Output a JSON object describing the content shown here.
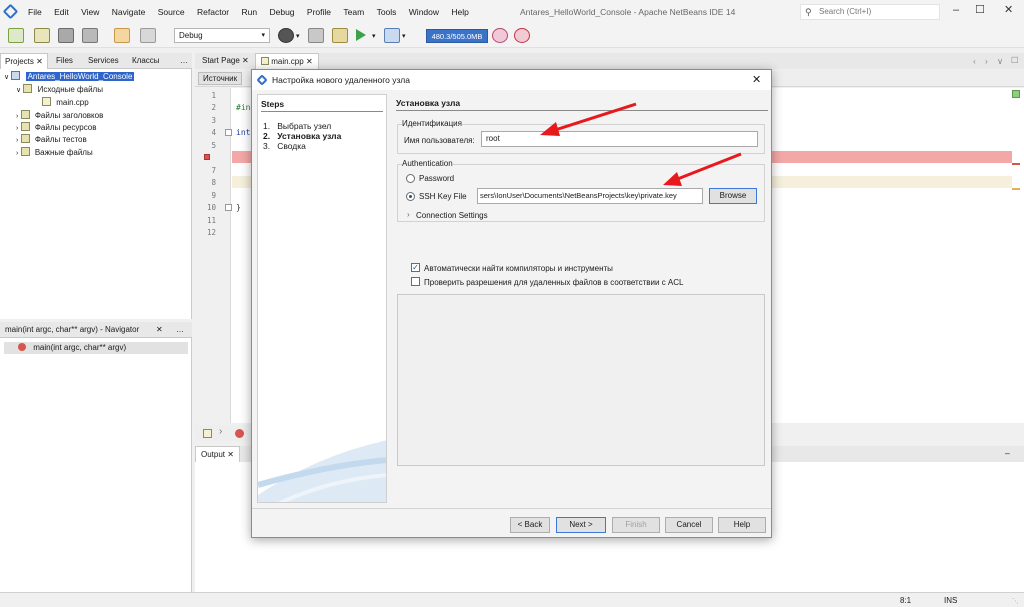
{
  "window": {
    "title": "Antares_HelloWorld_Console - Apache NetBeans IDE 14",
    "menu": [
      "File",
      "Edit",
      "View",
      "Navigate",
      "Source",
      "Refactor",
      "Run",
      "Debug",
      "Profile",
      "Team",
      "Tools",
      "Window",
      "Help"
    ],
    "search_placeholder": "Search (Ctrl+I)"
  },
  "toolbar": {
    "config": "Debug",
    "memory": "480.3/505.0MB"
  },
  "projects": {
    "tabs": [
      "Projects",
      "Files",
      "Services",
      "Классы"
    ],
    "tree": [
      {
        "label": "Antares_HelloWorld_Console",
        "level": 0,
        "selected": true
      },
      {
        "label": "Исходные файлы",
        "level": 1
      },
      {
        "label": "main.cpp",
        "level": 2
      },
      {
        "label": "Файлы заголовков",
        "level": 1
      },
      {
        "label": "Файлы ресурсов",
        "level": 1
      },
      {
        "label": "Файлы тестов",
        "level": 1
      },
      {
        "label": "Важные файлы",
        "level": 1
      }
    ]
  },
  "navigator": {
    "title": "main(int argc, char** argv) - Navigator",
    "item": "main(int argc, char** argv)"
  },
  "editor": {
    "tabs": [
      "Start Page",
      "main.cpp"
    ],
    "source_tab": "Источник",
    "line_numbers": [
      "1",
      "2",
      "3",
      "4",
      "5",
      "6",
      "7",
      "8",
      "9",
      "10",
      "11",
      "12"
    ],
    "code_include": "#in",
    "code_int": "int",
    "code_brace": "}"
  },
  "output": {
    "tab": "Output"
  },
  "statusbar": {
    "position": "8:1",
    "mode": "INS"
  },
  "dialog": {
    "title": "Настройка нового удаленного узла",
    "steps_title": "Steps",
    "steps": [
      {
        "num": "1.",
        "label": "Выбрать узел"
      },
      {
        "num": "2.",
        "label": "Установка узла",
        "current": true
      },
      {
        "num": "3.",
        "label": "Сводка"
      }
    ],
    "content_title": "Установка узла",
    "identification": {
      "legend": "Идентификация",
      "username_label": "Имя пользователя:",
      "username_value": "root"
    },
    "authentication": {
      "legend": "Authentication",
      "password_label": "Password",
      "ssh_label": "SSH Key File",
      "ssh_value": "sers\\IonUser\\Documents\\NetBeansProjects\\key\\private.key",
      "browse": "Browse",
      "connection_settings": "Connection Settings"
    },
    "auto_find_label": "Автоматически найти компиляторы и инструменты",
    "acl_label": "Проверить разрешения для удаленных файлов в соответствии с ACL",
    "buttons": {
      "back": "< Back",
      "next": "Next >",
      "finish": "Finish",
      "cancel": "Cancel",
      "help": "Help"
    }
  },
  "colors": {
    "accent": "#3b73c8",
    "arrow": "#e8191c",
    "error_line": "#f4a7a7"
  }
}
